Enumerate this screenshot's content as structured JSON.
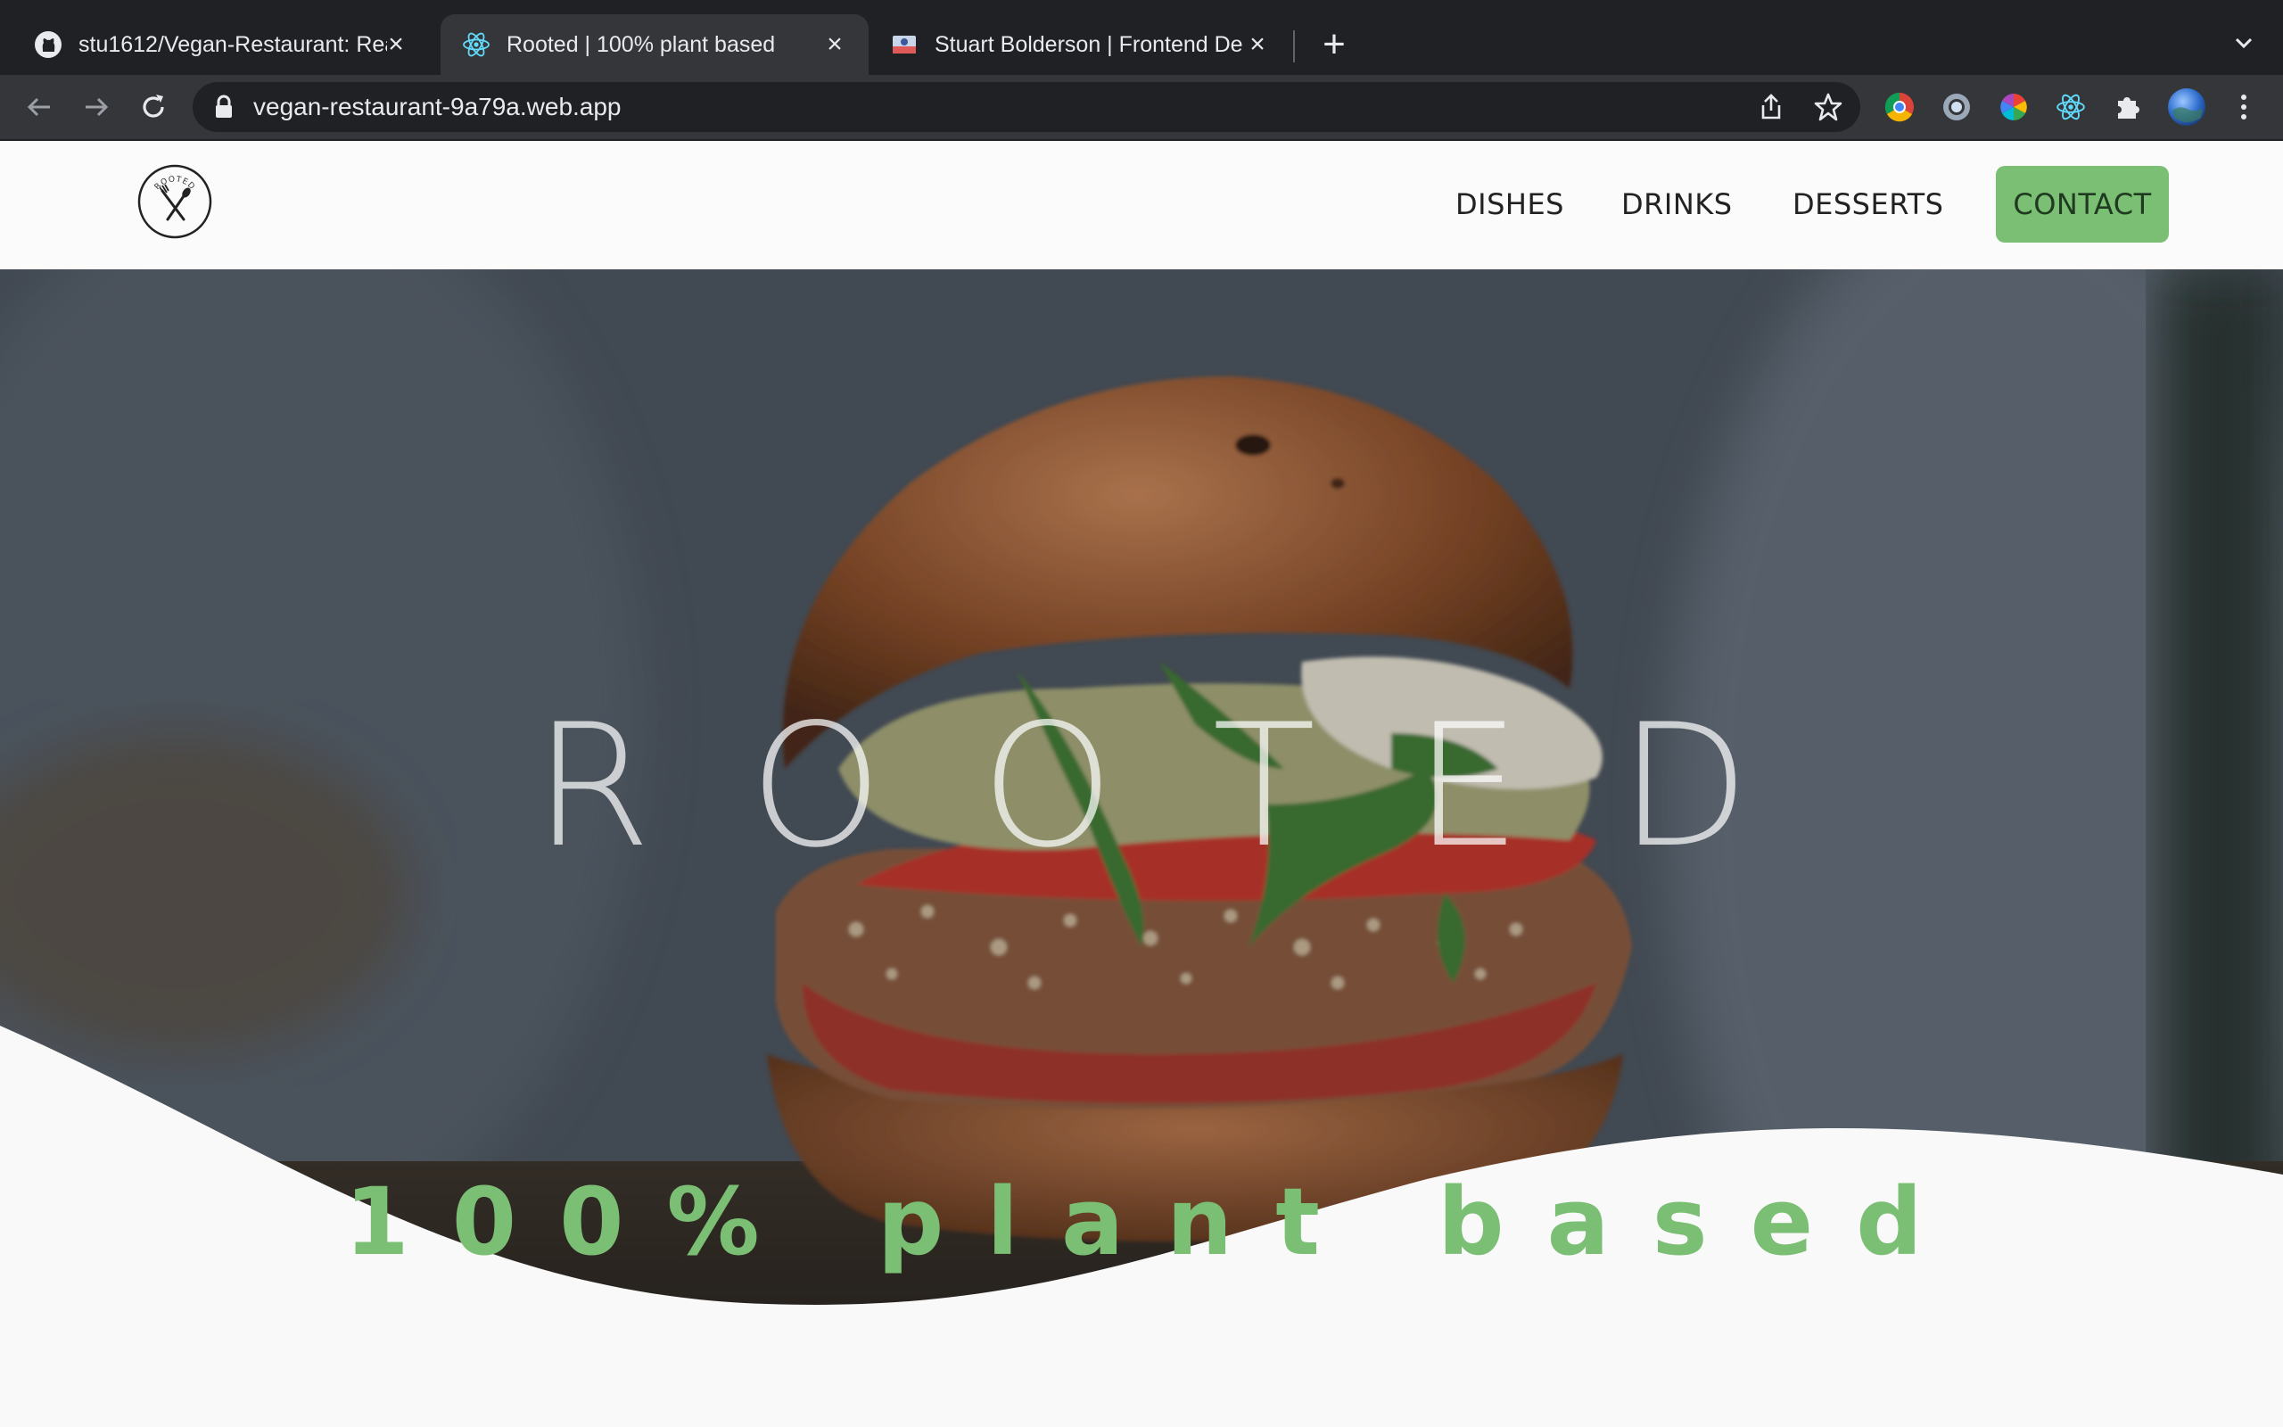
{
  "browser": {
    "tabs": [
      {
        "title": "stu1612/Vegan-Restaurant: Rea",
        "favicon": "github-icon",
        "active": false
      },
      {
        "title": "Rooted | 100% plant based",
        "favicon": "react-icon",
        "active": true
      },
      {
        "title": "Stuart Bolderson | Frontend De",
        "favicon": "portfolio-icon",
        "active": false
      }
    ],
    "url": "vegan-restaurant-9a79a.web.app"
  },
  "site": {
    "logo_text": "ROOTED",
    "nav": [
      "DISHES",
      "DRINKS",
      "DESSERTS"
    ],
    "contact_label": "CONTACT",
    "hero_title": "ROOTED",
    "tagline": "100% plant based"
  },
  "colors": {
    "accent_green": "#7bbf74",
    "tab_bg": "#202124",
    "toolbar_bg": "#35363a"
  }
}
